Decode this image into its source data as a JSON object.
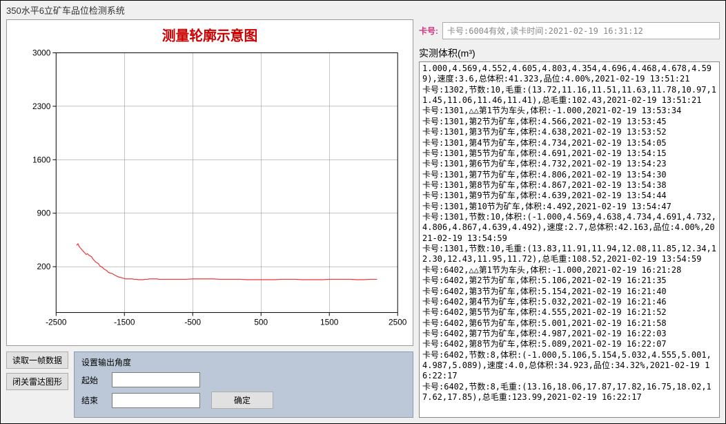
{
  "window": {
    "title": "350水平6立矿车品位检测系统"
  },
  "chart_data": {
    "type": "line",
    "title": "测量轮廓示意图",
    "xlabel": "",
    "ylabel": "",
    "xlim": [
      -2500,
      2500
    ],
    "ylim": [
      -400,
      3000
    ],
    "xticks": [
      -2500,
      -1500,
      -500,
      500,
      1500,
      2500
    ],
    "yticks": [
      200,
      900,
      1600,
      2300,
      3000
    ],
    "series": [
      {
        "name": "profile",
        "x": [
          -2200,
          -2180,
          -2160,
          -2140,
          -2120,
          -2100,
          -2080,
          -2060,
          -2040,
          -2020,
          -2000,
          -1980,
          -1960,
          -1940,
          -1920,
          -1900,
          -1880,
          -1860,
          -1840,
          -1820,
          -1800,
          -1780,
          -1760,
          -1740,
          -1720,
          -1700,
          -1680,
          -1660,
          -1640,
          -1620,
          -1600,
          -1580,
          -1560,
          -1540,
          -1520,
          -1500,
          -1480,
          -1460,
          -1440,
          -1420,
          -1400,
          -1380,
          -1360,
          -1340,
          -1320,
          -1300,
          -1280,
          -1260,
          -1240,
          -1220,
          -1200,
          -1180,
          -1160,
          -1140,
          -1120,
          -1100,
          -1080,
          -1060,
          -1040,
          -1020,
          -1000,
          -900,
          -800,
          -700,
          -600,
          -500,
          -400,
          -300,
          -200,
          -100,
          0,
          100,
          200,
          300,
          400,
          500,
          600,
          700,
          800,
          900,
          1000,
          1100,
          1200,
          1300,
          1400,
          1500,
          1600,
          1700,
          1800,
          1900,
          2000,
          2100,
          2200
        ],
        "y": [
          480,
          500,
          460,
          440,
          420,
          400,
          380,
          360,
          370,
          350,
          340,
          330,
          300,
          280,
          260,
          250,
          240,
          210,
          200,
          190,
          170,
          160,
          150,
          130,
          120,
          115,
          110,
          100,
          90,
          80,
          70,
          65,
          60,
          55,
          50,
          45,
          40,
          40,
          40,
          40,
          40,
          40,
          35,
          35,
          35,
          30,
          30,
          30,
          30,
          30,
          35,
          35,
          35,
          40,
          40,
          40,
          40,
          40,
          40,
          40,
          35,
          35,
          35,
          35,
          35,
          40,
          40,
          40,
          40,
          35,
          35,
          35,
          35,
          30,
          30,
          30,
          30,
          30,
          35,
          35,
          35,
          30,
          30,
          30,
          30,
          35,
          35,
          35,
          35,
          30,
          30,
          35,
          35
        ]
      }
    ]
  },
  "buttons": {
    "read_frame": "读取一帧数据",
    "close_radar": "闭关雷达图形",
    "confirm": "确定"
  },
  "angle_panel": {
    "title": "设置输出角度",
    "start_label": "起始",
    "end_label": "结束",
    "start_value": "",
    "end_value": ""
  },
  "card": {
    "label": "卡号:",
    "value": "卡号:6004有效,读卡时间:2021-02-19 16:31:12"
  },
  "volume": {
    "label": "实测体积(m³)"
  },
  "log_lines": [
    "1.000,4.569,4.552,4.605,4.803,4.354,4.696,4.468,4.678,4.599),速度:3.6,总体积:41.323,品位:4.00%,2021-02-19 13:51:21",
    "卡号:1302,节数:10,毛重:(13.72,11.16,11.51,11.63,11.78,10.97,11.45,11.06,11.46,11.41),总毛重:102.43,2021-02-19 13:51:21",
    "卡号:1301,△△第1节为车头,体积:-1.000,2021-02-19 13:53:34",
    "卡号:1301,第2节为矿车,体积:4.566,2021-02-19 13:53:45",
    "卡号:1301,第3节为矿车,体积:4.638,2021-02-19 13:53:52",
    "卡号:1301,第4节为矿车,体积:4.734,2021-02-19 13:54:05",
    "卡号:1301,第5节为矿车,体积:4.691,2021-02-19 13:54:15",
    "卡号:1301,第6节为矿车,体积:4.732,2021-02-19 13:54:23",
    "卡号:1301,第7节为矿车,体积:4.806,2021-02-19 13:54:30",
    "卡号:1301,第8节为矿车,体积:4.867,2021-02-19 13:54:38",
    "卡号:1301,第9节为矿车,体积:4.639,2021-02-19 13:54:44",
    "卡号:1301,第10节为矿车,体积:4.492,2021-02-19 13:54:47",
    "卡号:1301,节数:10,体积:(-1.000,4.569,4.638,4.734,4.691,4.732,4.806,4.867,4.639,4.492),速度:2.7,总体积:42.163,品位:4.00%,2021-02-19 13:54:59",
    "卡号:1301,节数:10,毛重:(13.83,11.91,11.94,12.08,11.85,12.34,12.30,12.43,11.95,11.72),总毛重:108.52,2021-02-19 13:54:59",
    "卡号:6402,△△第1节为车头,体积:-1.000,2021-02-19 16:21:28",
    "卡号:6402,第2节为矿车,体积:5.106,2021-02-19 16:21:35",
    "卡号:6402,第3节为矿车,体积:5.154,2021-02-19 16:21:40",
    "卡号:6402,第4节为矿车,体积:5.032,2021-02-19 16:21:46",
    "卡号:6402,第5节为矿车,体积:4.555,2021-02-19 16:21:52",
    "卡号:6402,第6节为矿车,体积:5.001,2021-02-19 16:21:58",
    "卡号:6402,第7节为矿车,体积:4.987,2021-02-19 16:22:03",
    "卡号:6402,第8节为矿车,体积:5.089,2021-02-19 16:22:07",
    "卡号:6402,节数:8,体积:(-1.000,5.106,5.154,5.032,4.555,5.001,4.987,5.089),速度:4.0,总体积:34.923,品位:34.32%,2021-02-19 16:22:17",
    "卡号:6402,节数:8,毛重:(13.16,18.06,17.87,17.82,16.75,18.02,17.62,17.85),总毛重:123.99,2021-02-19 16:22:17"
  ]
}
